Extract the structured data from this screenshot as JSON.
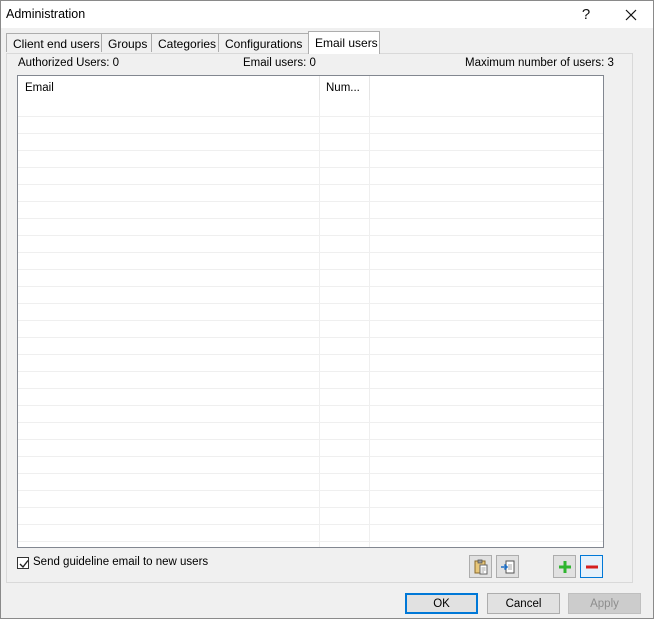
{
  "window": {
    "title": "Administration",
    "help_glyph": "?",
    "close_glyph": "✕"
  },
  "tabs": [
    {
      "label": "Client end users",
      "active": false
    },
    {
      "label": "Groups",
      "active": false
    },
    {
      "label": "Categories",
      "active": false
    },
    {
      "label": "Configurations",
      "active": false
    },
    {
      "label": "Email users",
      "active": true
    }
  ],
  "summary": {
    "authorized_users": "Authorized Users: 0",
    "email_users": "Email users: 0",
    "max_users": "Maximum number of users: 3"
  },
  "list": {
    "columns": [
      "Email",
      "Num..."
    ],
    "rows": []
  },
  "options": {
    "send_guideline_label": "Send guideline email to new users",
    "send_guideline_checked": true
  },
  "toolbar": {
    "icons": [
      "clipboard-icon",
      "import-icon",
      "add-icon",
      "remove-icon"
    ],
    "add_color": "#2fb52f",
    "remove_color": "#d42020"
  },
  "buttons": {
    "ok": "OK",
    "cancel": "Cancel",
    "apply": "Apply"
  },
  "colors": {
    "accent": "#0078d7",
    "dialog_bg": "#f0f0f0"
  }
}
